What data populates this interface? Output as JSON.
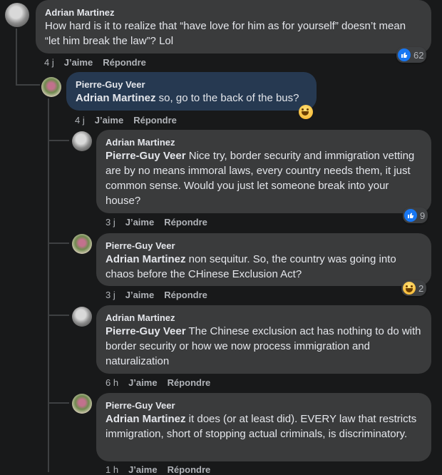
{
  "comments": [
    {
      "author": "Adrian Martinez",
      "mention": "",
      "text": "How hard is it to realize that “have love for him as for yourself” doesn’t mean “let him break the law”? Lol",
      "time": "4 j",
      "like": "J’aime",
      "reply": "Répondre",
      "reaction_icon": "like-icon",
      "reaction_count": "62"
    },
    {
      "author": "Pierre-Guy Veer",
      "mention": "Adrian Martinez",
      "text": " so, go to the back of the bus?",
      "time": "4 j",
      "like": "J’aime",
      "reply": "Répondre",
      "reaction_icon": "haha-icon",
      "reaction_count": ""
    },
    {
      "author": "Adrian Martinez",
      "mention": "Pierre-Guy Veer",
      "text": " Nice try, border security and immigration vetting are by no means immoral laws, every country needs them, it just common sense. Would you just let someone break into your house?",
      "time": "3 j",
      "like": "J’aime",
      "reply": "Répondre",
      "reaction_icon": "like-icon",
      "reaction_count": "9"
    },
    {
      "author": "Pierre-Guy Veer",
      "mention": "Adrian Martinez",
      "text": " non sequitur. So, the country was going into chaos before the CHinese Exclusion Act?",
      "time": "3 j",
      "like": "J’aime",
      "reply": "Répondre",
      "reaction_icon": "haha-icon",
      "reaction_count": "2"
    },
    {
      "author": "Adrian Martinez",
      "mention": "Pierre-Guy Veer",
      "text": " The Chinese exclusion act has nothing to do with border security or how we now process immigration and naturalization",
      "time": "6 h",
      "like": "J’aime",
      "reply": "Répondre",
      "reaction_icon": "",
      "reaction_count": ""
    },
    {
      "author": "Pierre-Guy Veer",
      "mention": "Adrian Martinez",
      "text": " it does (or at least did). EVERY law that restricts immigration, short of stopping actual criminals, is discriminatory.",
      "time": "1 h",
      "like": "J’aime",
      "reply": "Répondre",
      "reaction_icon": "",
      "reaction_count": ""
    }
  ]
}
